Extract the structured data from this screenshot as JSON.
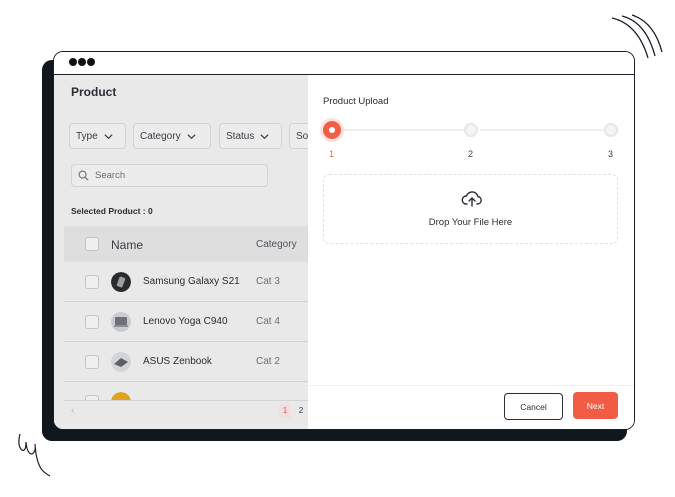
{
  "window": {
    "title_dots": 3
  },
  "app": {
    "title": "Product",
    "filters": [
      {
        "label": "Type"
      },
      {
        "label": "Category"
      },
      {
        "label": "Status"
      },
      {
        "label": "So"
      }
    ],
    "search": {
      "placeholder": "Search"
    },
    "selected_label": "Selected Product : 0",
    "table": {
      "columns": [
        "Name",
        "Category"
      ],
      "rows": [
        {
          "name": "Samsung Galaxy S21",
          "category": "Cat 3",
          "thumb_icon": "phone-thumb"
        },
        {
          "name": "Lenovo Yoga C940",
          "category": "Cat 4",
          "thumb_icon": "laptop-thumb"
        },
        {
          "name": "ASUS Zenbook",
          "category": "Cat 2",
          "thumb_icon": "laptop-thumb"
        },
        {
          "name": "",
          "category": "",
          "thumb_icon": "product-thumb"
        }
      ]
    },
    "pagination": {
      "pages": [
        "1",
        "2"
      ],
      "current": "1"
    }
  },
  "upload_panel": {
    "title": "Product Upload",
    "steps": [
      {
        "number": "1",
        "state": "active"
      },
      {
        "number": "2",
        "state": "pending"
      },
      {
        "number": "3",
        "state": "pending"
      }
    ],
    "dropzone_text": "Drop Your File Here",
    "dropzone_icon": "cloud-upload-icon",
    "cancel_label": "Cancel",
    "next_label": "Next"
  },
  "colors": {
    "accent": "#f25c45",
    "overlay": "#e9e9ea",
    "frame": "#1b1e26"
  }
}
